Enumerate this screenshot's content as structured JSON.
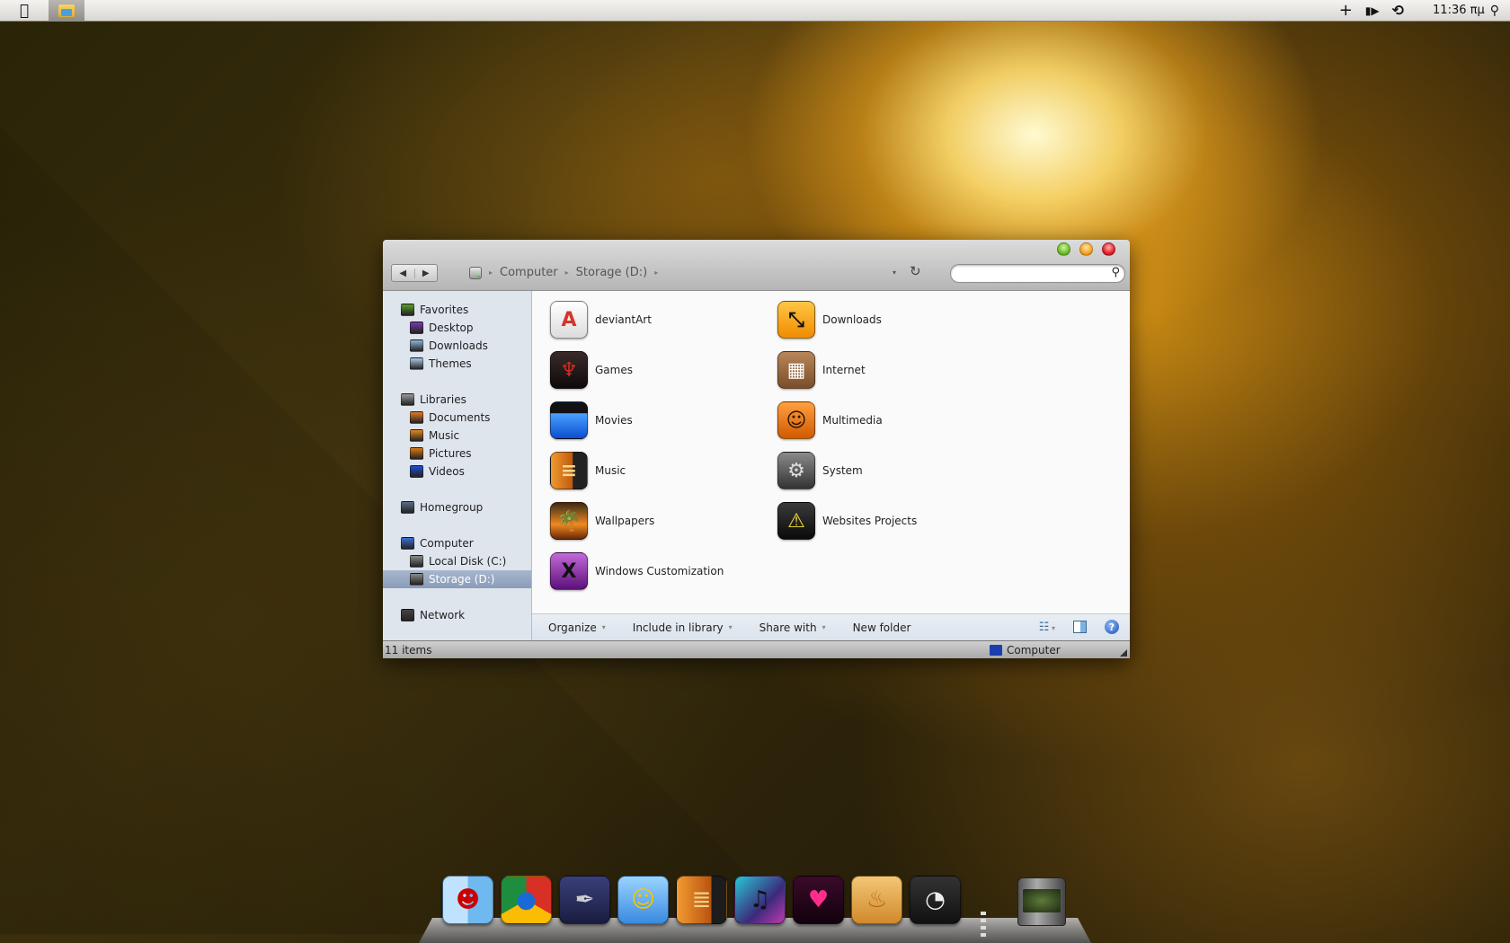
{
  "menubar": {
    "apple_icon": "apple-logo-icon",
    "active_app_icon": "explorer-folder-icon",
    "tray": [
      {
        "name": "add-icon",
        "glyph": "+"
      },
      {
        "name": "volume-icon",
        "glyph": "🔈"
      },
      {
        "name": "time-machine-icon",
        "glyph": "⟲"
      }
    ],
    "clock": "11:36 πμ",
    "spotlight_glyph": "🔍"
  },
  "window": {
    "controls": [
      "maximize",
      "minimize",
      "close"
    ],
    "nav": {
      "back": "◀",
      "forward": "▶"
    },
    "breadcrumb": [
      "Computer",
      "Storage (D:)"
    ],
    "breadcrumb_sep": "▸",
    "dropdown_glyph": "▾",
    "refresh_glyph": "↻",
    "search": {
      "value": "",
      "placeholder": "",
      "icon": "🔍"
    },
    "sidebar": {
      "groups": [
        {
          "label": "Favorites",
          "color": "#5a9e2a",
          "children": [
            {
              "label": "Desktop",
              "color": "#7a3ca8"
            },
            {
              "label": "Downloads",
              "color": "#8fb4d6"
            },
            {
              "label": "Themes",
              "color": "#a9c8e6"
            }
          ]
        },
        {
          "label": "Libraries",
          "color": "#9a9a9a",
          "children": [
            {
              "label": "Documents",
              "color": "#e07a2a"
            },
            {
              "label": "Music",
              "color": "#e08a20"
            },
            {
              "label": "Pictures",
              "color": "#d97a18"
            },
            {
              "label": "Videos",
              "color": "#1f4fd0"
            }
          ]
        },
        {
          "label": "Homegroup",
          "color": "#5a6f88",
          "children": []
        },
        {
          "label": "Computer",
          "color": "#3e6fd1",
          "children": [
            {
              "label": "Local Disk (C:)",
              "color": "#8a8a8a"
            },
            {
              "label": "Storage (D:)",
              "color": "#8a8a8a",
              "selected": true
            }
          ]
        },
        {
          "label": "Network",
          "color": "#444444",
          "children": []
        }
      ]
    },
    "files": [
      {
        "name": "deviantArt",
        "icon": "app-store-icon",
        "bg": "linear-gradient(#ffffff,#dcdcdc)",
        "fg": "#d2362a",
        "glyph": "A"
      },
      {
        "name": "Downloads",
        "icon": "resize-arrow-icon",
        "bg": "linear-gradient(#ffc645,#f08c00)",
        "fg": "#111",
        "glyph": "⤡"
      },
      {
        "name": "Games",
        "icon": "horde-icon",
        "bg": "linear-gradient(#3a2a2a,#0e0a0a)",
        "fg": "#d12c1e",
        "glyph": "♆"
      },
      {
        "name": "Internet",
        "icon": "corkboard-icon",
        "bg": "linear-gradient(#b88659,#7a4e2a)",
        "fg": "#fff",
        "glyph": "▦"
      },
      {
        "name": "Movies",
        "icon": "clapperboard-icon",
        "bg": "linear-gradient(#111 0%,#111 30%,#4aa0ff 31%,#0a4fd0 100%)",
        "fg": "#fff",
        "glyph": ""
      },
      {
        "name": "Multimedia",
        "icon": "finder-pumpkin-icon",
        "bg": "linear-gradient(#ffa040,#d05a00)",
        "fg": "#2a1200",
        "glyph": "☺"
      },
      {
        "name": "Music",
        "icon": "guitar-icon",
        "bg": "linear-gradient(90deg,#f09a30,#c05a10 60%,#222 61%)",
        "fg": "#f3d890",
        "glyph": "≡"
      },
      {
        "name": "System",
        "icon": "gear-icon",
        "bg": "linear-gradient(#8a8a8a,#333)",
        "fg": "#ddd",
        "glyph": "⚙"
      },
      {
        "name": "Wallpapers",
        "icon": "palm-sunset-icon",
        "bg": "linear-gradient(#3a2a18,#f08a20 60%,#6a2a08)",
        "fg": "#111",
        "glyph": "🌴"
      },
      {
        "name": "Websites Projects",
        "icon": "warning-icon",
        "bg": "linear-gradient(#3a3a3a,#0a0a0a)",
        "fg": "#f3e23a",
        "glyph": "⚠"
      },
      {
        "name": "Windows Customization",
        "icon": "osx-x-icon",
        "bg": "linear-gradient(#c36ad8,#5c0f7a)",
        "fg": "#111",
        "glyph": "X"
      }
    ],
    "commands": [
      "Organize",
      "Include in library",
      "Share with",
      "New folder"
    ],
    "commands_with_arrow": [
      true,
      true,
      true,
      false
    ],
    "cmd_arrow": "▾",
    "view_icons": [
      {
        "name": "change-view-icon",
        "glyph": "☷▾"
      },
      {
        "name": "preview-pane-icon",
        "glyph": "▥"
      },
      {
        "name": "help-icon",
        "glyph": "?"
      }
    ],
    "status": {
      "count": "11 items",
      "location": "Computer"
    }
  },
  "dock": {
    "icons": [
      {
        "name": "finder-devil-icon",
        "bg": "linear-gradient(90deg,#bfe3ff 50%,#6fb8f0 50%)",
        "glyph": "☻",
        "fg": "#c00"
      },
      {
        "name": "chrome-icon",
        "bg": "conic-gradient(#d93025 0 120deg,#fbbc04 120deg 240deg,#1e8e3e 240deg)",
        "glyph": "●",
        "fg": "#1a6ad6"
      },
      {
        "name": "pen-app-icon",
        "bg": "linear-gradient(#3a3f7a,#1a1d40)",
        "glyph": "✒",
        "fg": "#ccc"
      },
      {
        "name": "smiley-messenger-icon",
        "bg": "linear-gradient(#9ad4ff,#3a8ae0)",
        "glyph": "☺",
        "fg": "#f5c400"
      },
      {
        "name": "garageband-guitar-icon",
        "bg": "linear-gradient(90deg,#f29b32,#b8530f 70%,#1c1c1c 70%)",
        "glyph": "≣",
        "fg": "#f1d28a"
      },
      {
        "name": "itunes-icon",
        "bg": "linear-gradient(135deg,#2ac7d4,#3b2a7a 60%,#c03ab0)",
        "glyph": "♫",
        "fg": "#111"
      },
      {
        "name": "heart-app-icon",
        "bg": "linear-gradient(#3a0a2a,#12020c)",
        "glyph": "♥",
        "fg": "#ff2e8a"
      },
      {
        "name": "flame-app-icon",
        "bg": "linear-gradient(#f3c676,#d08a2a)",
        "glyph": "♨",
        "fg": "#b5651d"
      },
      {
        "name": "dashboard-icon",
        "bg": "linear-gradient(#333,#111)",
        "glyph": "◔",
        "fg": "#eee"
      }
    ],
    "trash_icon": "trash-icon"
  }
}
